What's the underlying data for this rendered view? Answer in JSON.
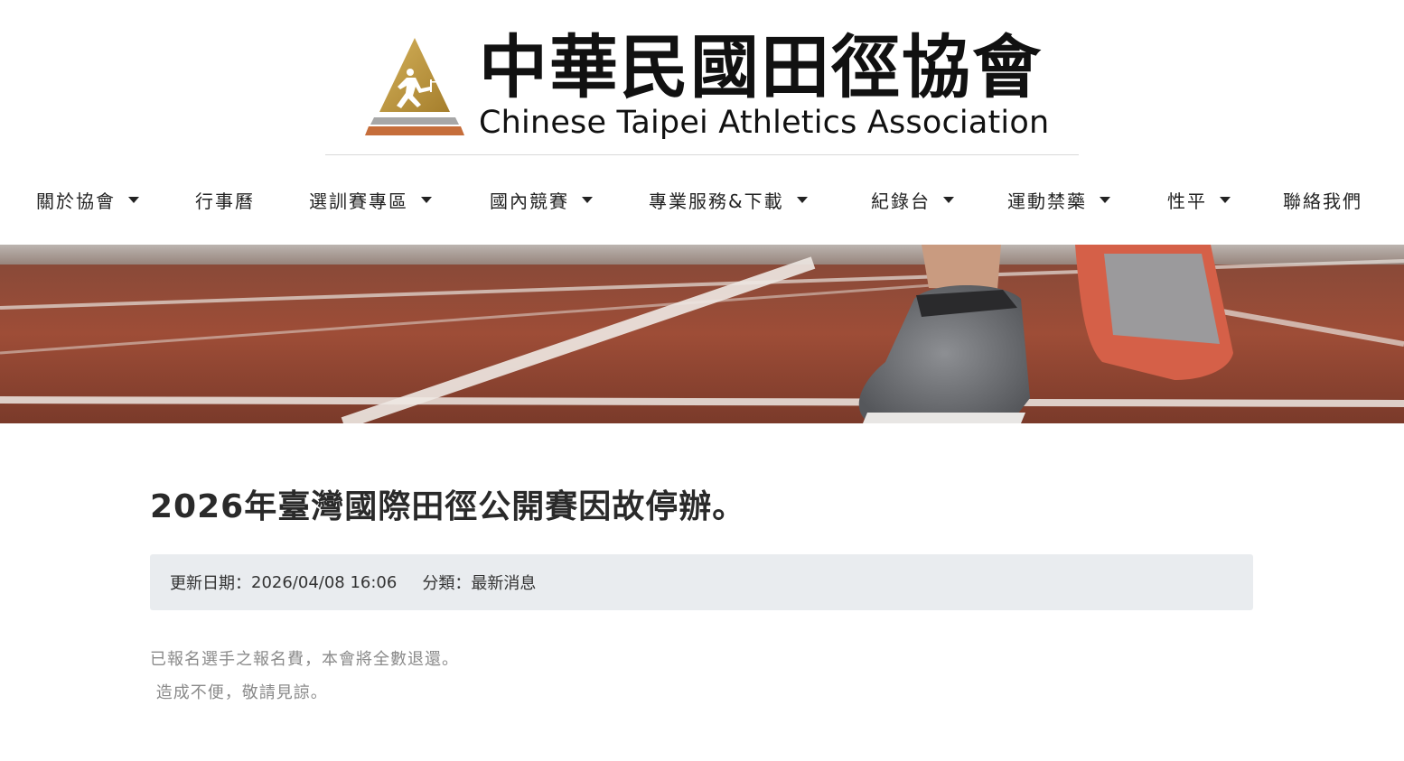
{
  "header": {
    "logo_title": "中華民國田徑協會",
    "logo_subtitle": "Chinese Taipei Athletics Association"
  },
  "nav": {
    "items": [
      {
        "label": "關於協會",
        "dropdown": true
      },
      {
        "label": "行事曆",
        "dropdown": false
      },
      {
        "label": "選訓賽專區",
        "dropdown": true
      },
      {
        "label": "國內競賽",
        "dropdown": true
      },
      {
        "label": "專業服務&下載",
        "dropdown": true
      },
      {
        "label": "紀錄台",
        "dropdown": true
      },
      {
        "label": "運動禁藥",
        "dropdown": true
      },
      {
        "label": "性平",
        "dropdown": true
      },
      {
        "label": "聯絡我們",
        "dropdown": false
      }
    ]
  },
  "article": {
    "title": "2026年臺灣國際田徑公開賽因故停辦。",
    "updated_label": "更新日期：",
    "updated_value": "2026/04/08 16:06",
    "category_label": "分類：",
    "category_value": "最新消息",
    "body": [
      "已報名選手之報名費，本會將全數退還。",
      " 造成不便，敬請見諒。"
    ]
  },
  "colors": {
    "logo_gold": "#b8923a",
    "logo_gray": "#9a9a9a",
    "logo_orange": "#c8703a",
    "track_red": "#9b4a36",
    "meta_bg": "#e9ecef"
  }
}
